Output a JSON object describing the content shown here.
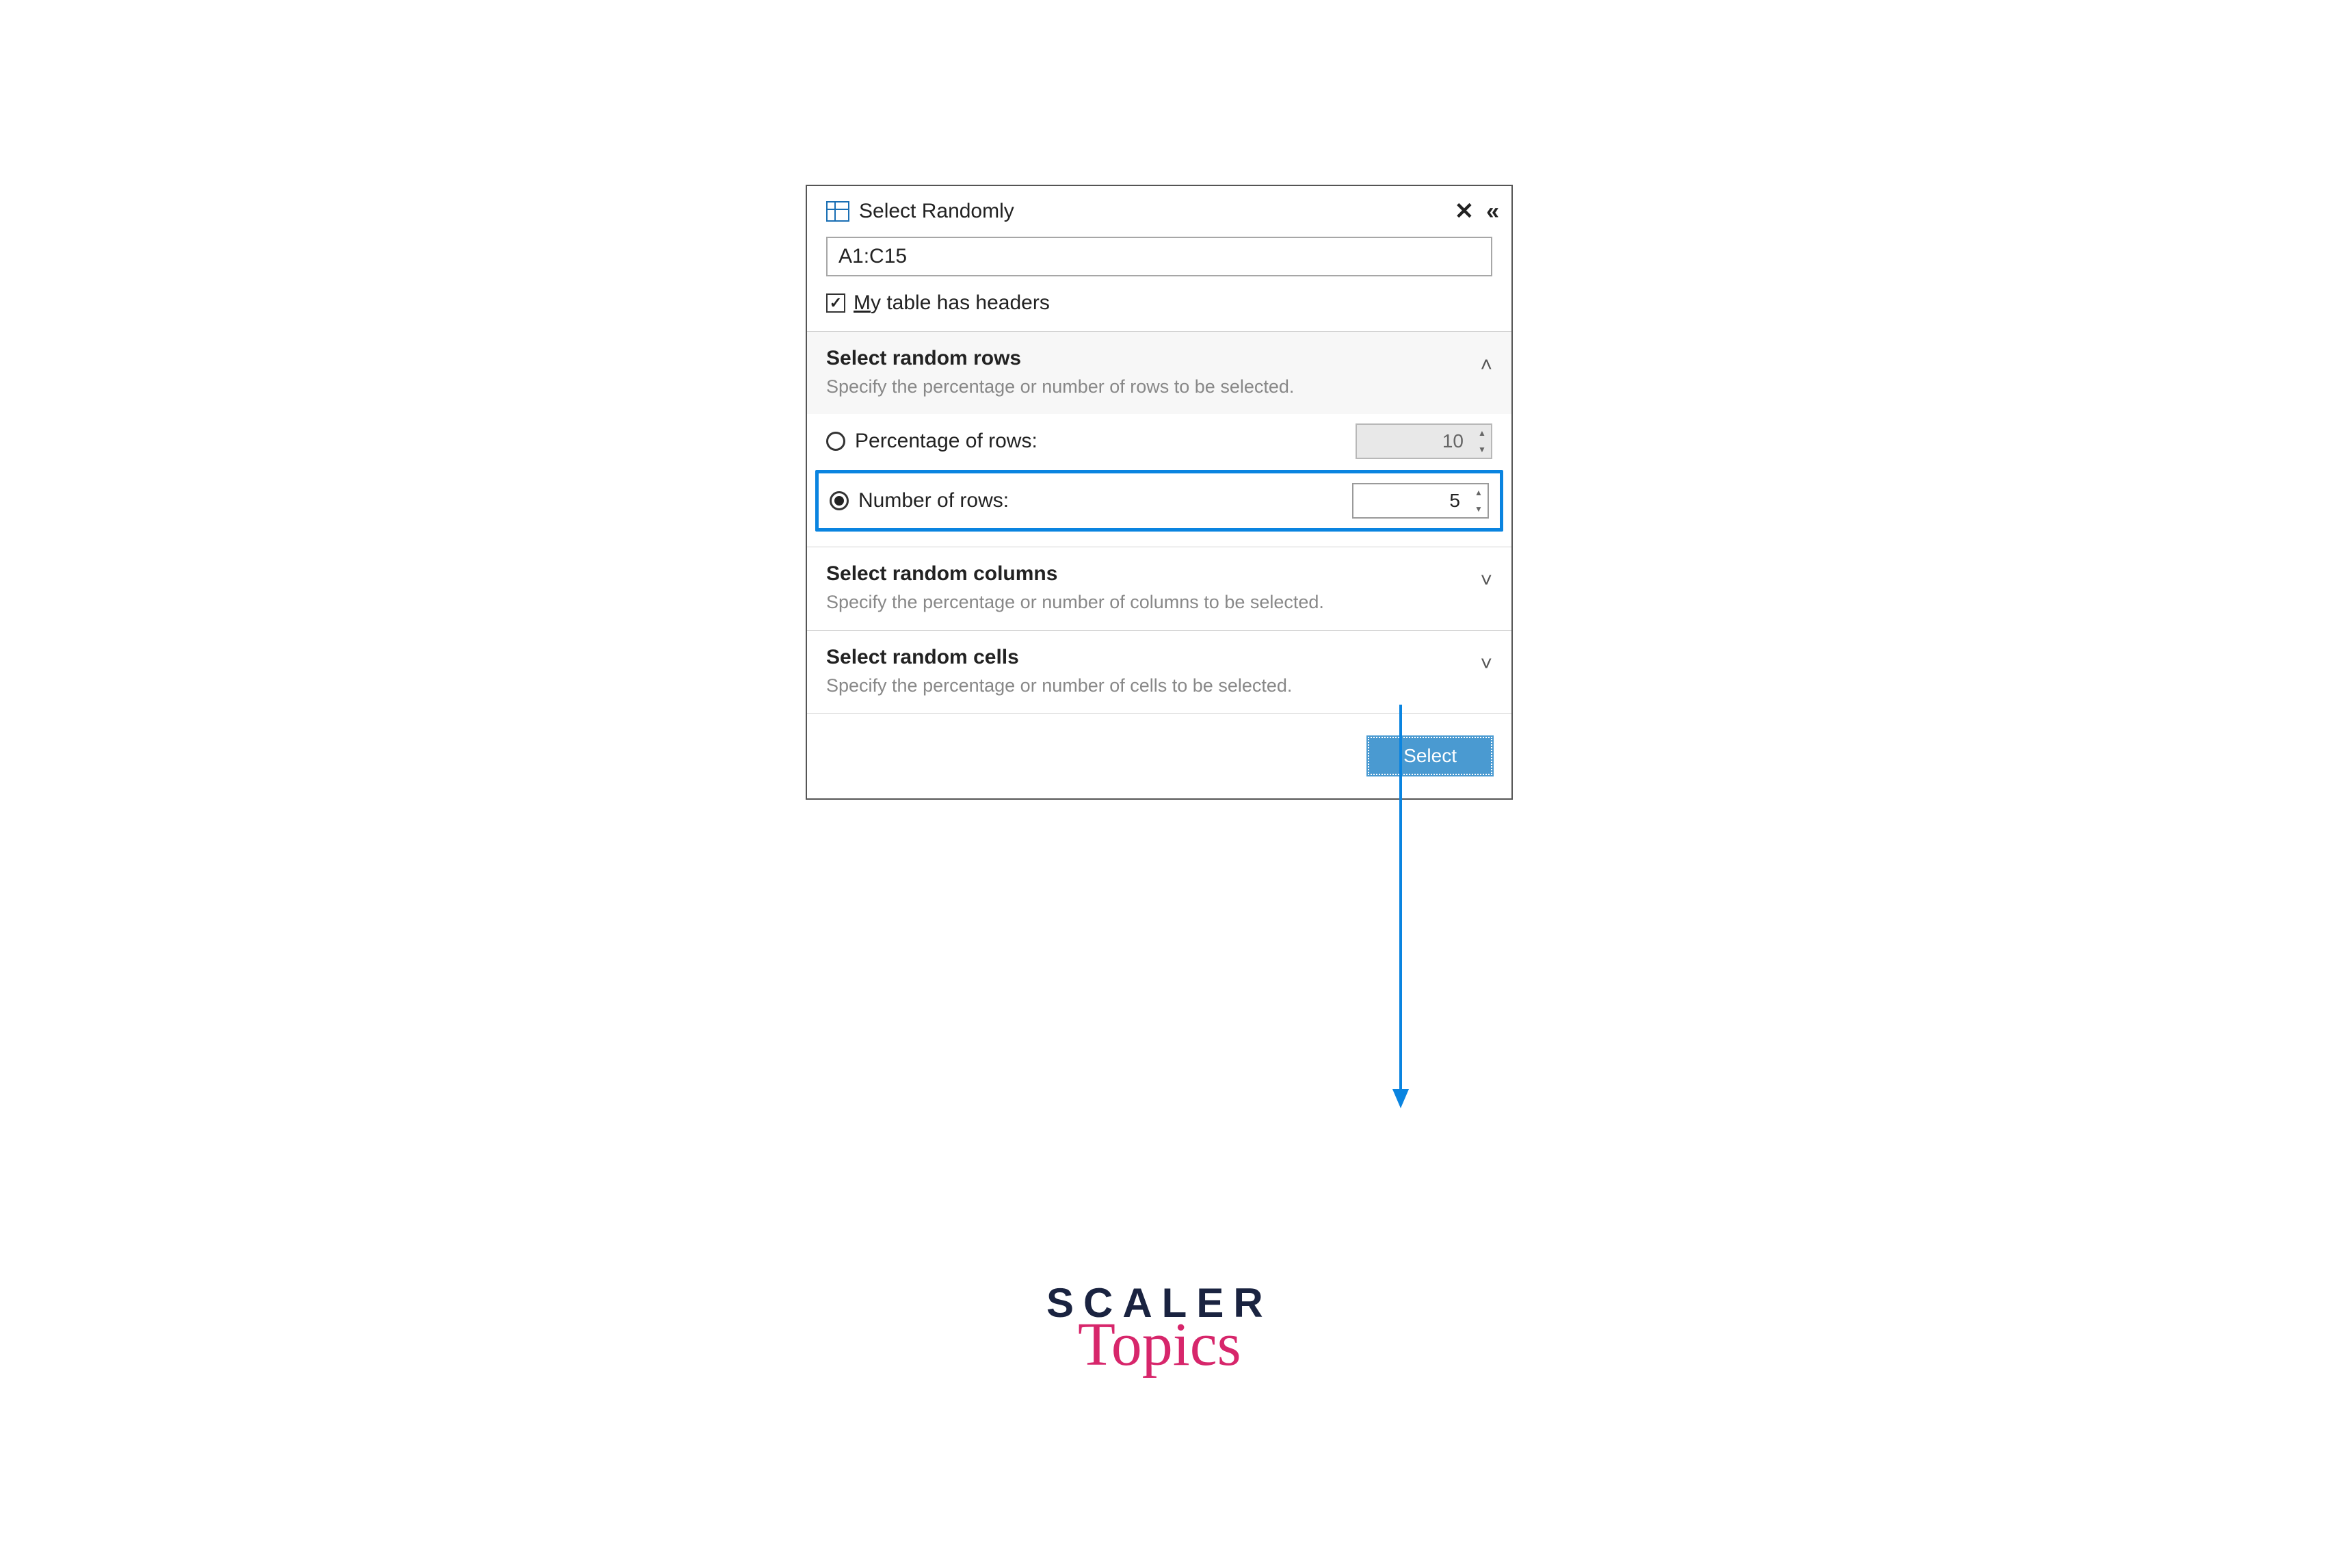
{
  "panel": {
    "title": "Select Randomly",
    "range_value": "A1:C15",
    "headers_checkbox": {
      "checked": true,
      "label_prefix": "M",
      "label_rest": "y table has headers"
    }
  },
  "sections": {
    "rows": {
      "title": "Select random rows",
      "desc": "Specify the percentage or number of rows to be selected.",
      "expanded": true,
      "percentage_label": "Percentage of rows:",
      "percentage_value": "10",
      "number_label": "Number of rows:",
      "number_value": "5"
    },
    "columns": {
      "title": "Select random columns",
      "desc": "Specify the percentage or number of columns to be selected."
    },
    "cells": {
      "title": "Select random cells",
      "desc": "Specify the percentage or number of cells to be selected."
    }
  },
  "footer": {
    "select_label": "Select"
  },
  "branding": {
    "line1": "SCALER",
    "line2": "Topics"
  }
}
